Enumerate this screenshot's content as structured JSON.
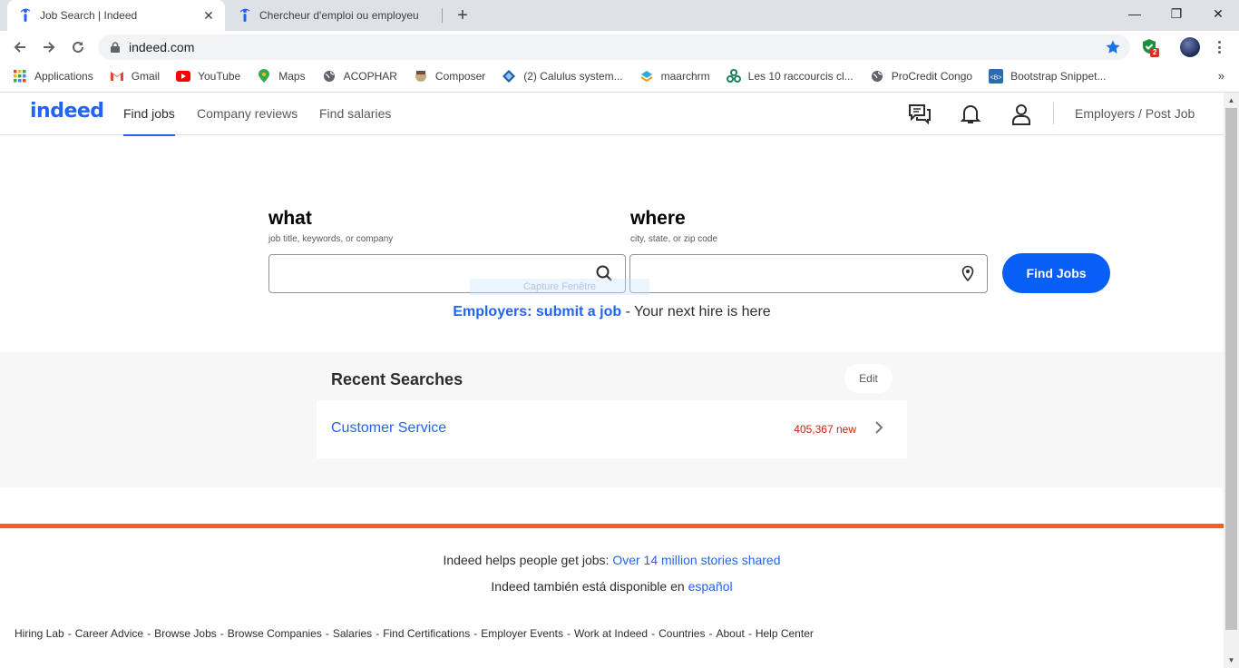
{
  "browser": {
    "tabs": [
      {
        "title": "Job Search | Indeed",
        "active": true
      },
      {
        "title": "Chercheur d'emploi ou employeu",
        "active": false
      }
    ],
    "close_glyph": "✕",
    "new_tab_glyph": "+",
    "window_controls": {
      "minimize": "—",
      "restore": "❐",
      "close": "✕"
    },
    "url": "indeed.com",
    "extension_badge": "2",
    "bookmarks": [
      {
        "label": "Applications",
        "icon": "apps-grid-icon"
      },
      {
        "label": "Gmail",
        "icon": "gmail-icon"
      },
      {
        "label": "YouTube",
        "icon": "youtube-icon"
      },
      {
        "label": "Maps",
        "icon": "maps-icon"
      },
      {
        "label": "ACOPHAR",
        "icon": "globe-icon"
      },
      {
        "label": "Composer",
        "icon": "composer-icon"
      },
      {
        "label": "(2) Calulus system...",
        "icon": "calulus-icon"
      },
      {
        "label": "maarchrm",
        "icon": "maarchrm-icon"
      },
      {
        "label": "Les 10 raccourcis cl...",
        "icon": "raccourcis-icon"
      },
      {
        "label": "ProCredit Congo",
        "icon": "globe-icon"
      },
      {
        "label": "Bootstrap Snippet...",
        "icon": "bootstrap-icon"
      }
    ],
    "bookmarks_more": "»"
  },
  "header": {
    "logo": "indeed",
    "nav": {
      "find_jobs": "Find jobs",
      "company_reviews": "Company reviews",
      "find_salaries": "Find salaries"
    },
    "employers_post_job": "Employers / Post Job"
  },
  "search": {
    "what_label": "what",
    "what_sub": "job title, keywords, or company",
    "what_value": "",
    "where_label": "where",
    "where_sub": "city, state, or zip code",
    "where_value": "",
    "button": "Find Jobs",
    "overlay_hint": "Capture Fenêtre",
    "employers_link": "Employers: submit a job",
    "employers_rest": " - Your next hire is here"
  },
  "recent": {
    "title": "Recent Searches",
    "edit": "Edit",
    "items": [
      {
        "query": "Customer Service",
        "count": "405,367 new"
      }
    ]
  },
  "footer": {
    "line1_text": "Indeed helps people get jobs: ",
    "line1_link": "Over 14 million stories shared",
    "line2_text": "Indeed también está disponible en ",
    "line2_link": "español",
    "links": [
      "Hiring Lab",
      "Career Advice",
      "Browse Jobs",
      "Browse Companies",
      "Salaries",
      "Find Certifications",
      "Employer Events",
      "Work at Indeed",
      "Countries",
      "About",
      "Help Center"
    ],
    "separator": "-"
  },
  "colors": {
    "accent": "#2164f3",
    "button": "#085ff7",
    "orange": "#ff5a1f",
    "count_red": "#c8250b"
  }
}
